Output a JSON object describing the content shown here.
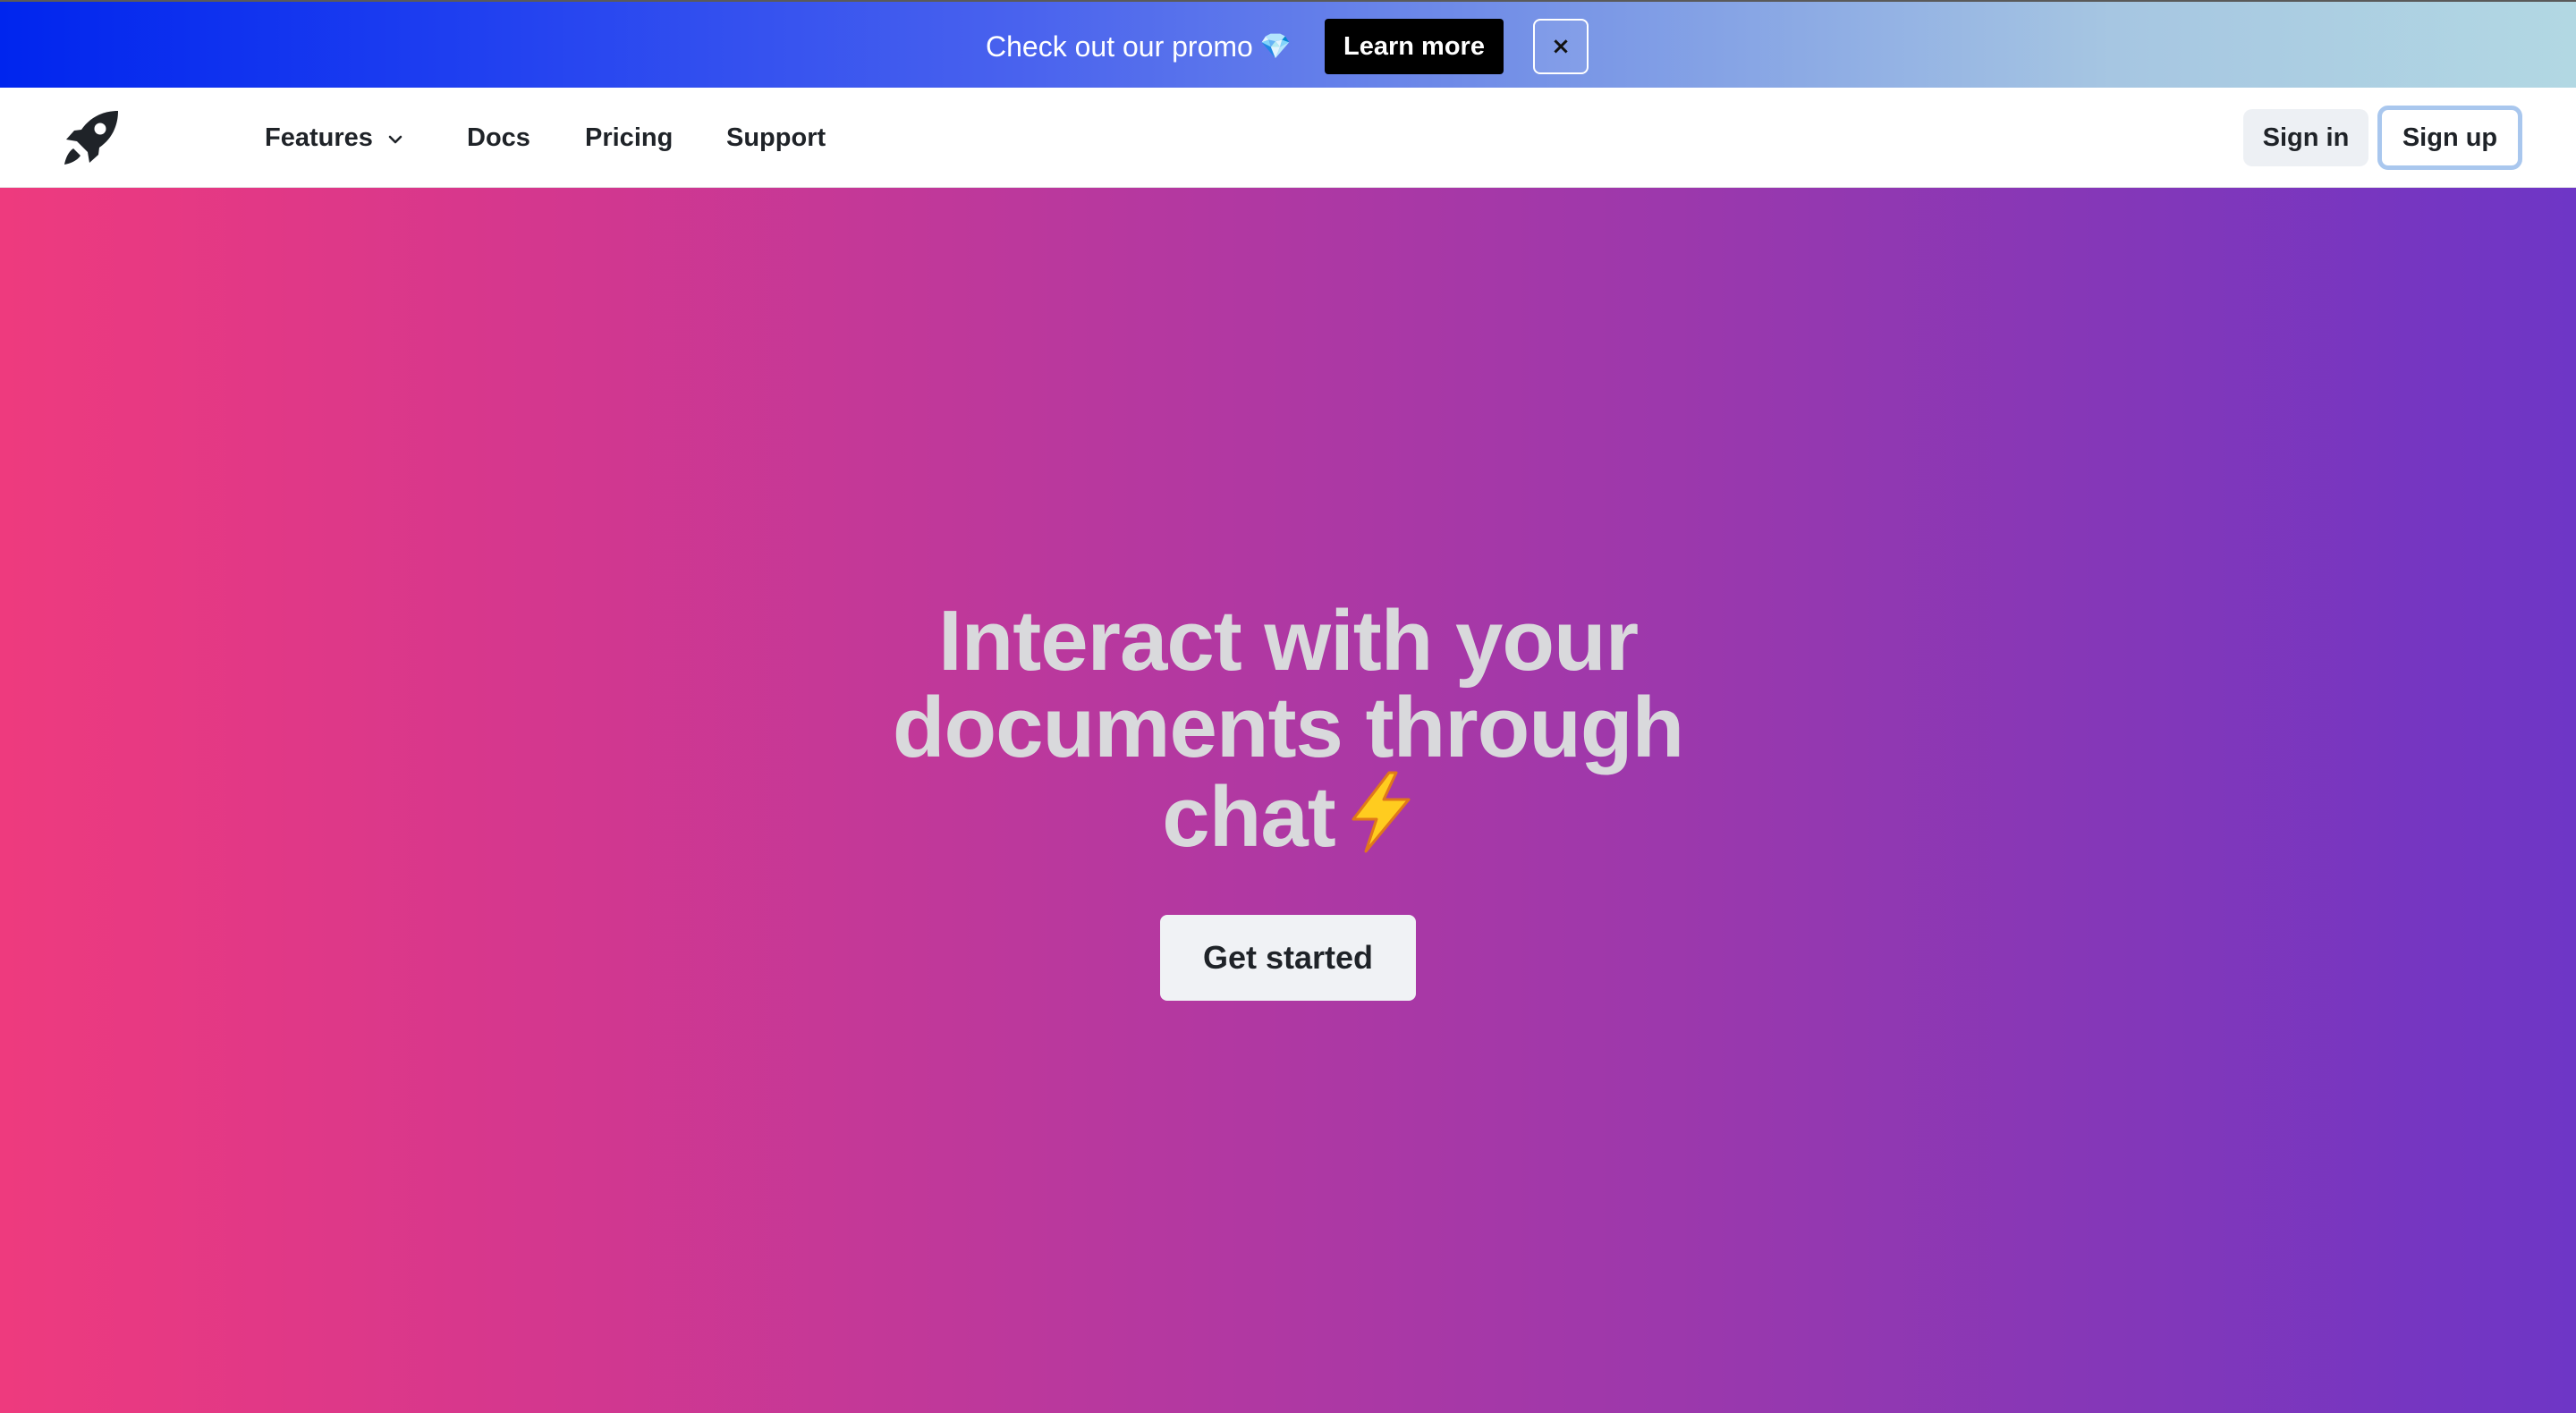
{
  "promo": {
    "text": "Check out our promo",
    "gem_icon": "💎",
    "learn_more_label": "Learn more",
    "close_label": "×"
  },
  "nav": {
    "logo_icon": "rocket-icon",
    "links": [
      {
        "label": "Features",
        "has_dropdown": true
      },
      {
        "label": "Docs"
      },
      {
        "label": "Pricing"
      },
      {
        "label": "Support"
      }
    ],
    "sign_in_label": "Sign in",
    "sign_up_label": "Sign up"
  },
  "hero": {
    "title": "Interact with your documents through chat",
    "title_icon": "lightning-icon",
    "cta_label": "Get started"
  },
  "colors": {
    "promo_gradient_start": "#0025ee",
    "promo_gradient_end": "#b2d8e3",
    "hero_gradient_start": "#ee3a7e",
    "hero_gradient_end": "#6e36c6",
    "signup_focus_ring": "#a9c7ee"
  }
}
